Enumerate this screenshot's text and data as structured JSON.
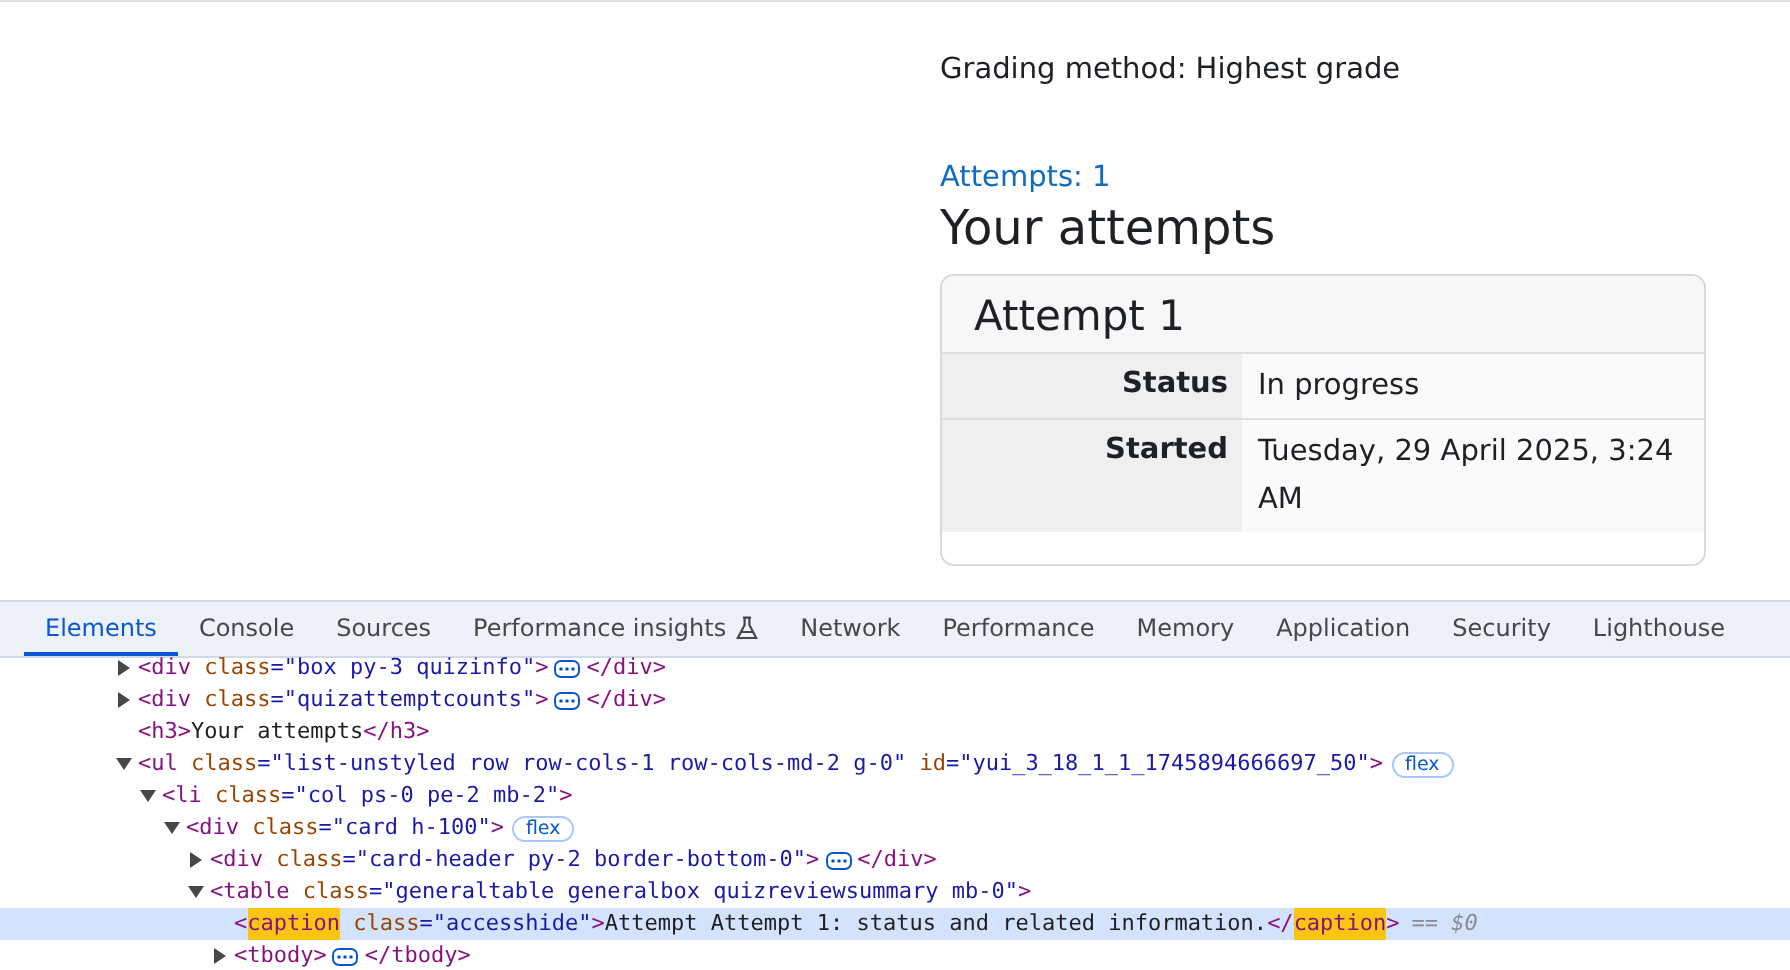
{
  "page": {
    "grading_method": "Grading method: Highest grade",
    "attempts_link": "Attempts: 1",
    "heading": "Your attempts",
    "card": {
      "title": "Attempt 1",
      "rows": [
        {
          "label": "Status",
          "value": "In progress"
        },
        {
          "label": "Started",
          "value": "Tuesday, 29 April 2025, 3:24 AM"
        }
      ]
    }
  },
  "devtools": {
    "tabs": [
      {
        "label": "Elements",
        "selected": true
      },
      {
        "label": "Console",
        "selected": false
      },
      {
        "label": "Sources",
        "selected": false
      },
      {
        "label": "Performance insights",
        "selected": false,
        "kind": "experiment"
      },
      {
        "label": "Network",
        "selected": false
      },
      {
        "label": "Performance",
        "selected": false
      },
      {
        "label": "Memory",
        "selected": false
      },
      {
        "label": "Application",
        "selected": false
      },
      {
        "label": "Security",
        "selected": false
      },
      {
        "label": "Lighthouse",
        "selected": false
      }
    ],
    "nodes": [
      {
        "expanded": false,
        "selected": false,
        "tokens": [
          {
            "kind": "tag",
            "text": "<div"
          },
          {
            "kind": "attr",
            "text": "class"
          },
          {
            "kind": "value",
            "text": "=\"box py-3 quizinfo\""
          },
          {
            "kind": "tag",
            "text": ">"
          },
          {
            "kind": "ellipsis"
          },
          {
            "kind": "tag",
            "text": "</div>"
          }
        ]
      },
      {
        "expanded": false,
        "selected": false,
        "tokens": [
          {
            "kind": "tag",
            "text": "<div"
          },
          {
            "kind": "attr",
            "text": "class"
          },
          {
            "kind": "value",
            "text": "=\"quizattemptcounts\""
          },
          {
            "kind": "tag",
            "text": ">"
          },
          {
            "kind": "ellipsis"
          },
          {
            "kind": "tag",
            "text": "</div>"
          }
        ]
      },
      {
        "selected": false,
        "tokens": [
          {
            "kind": "tag",
            "text": "<h3>"
          },
          {
            "kind": "text",
            "text": "Your attempts"
          },
          {
            "kind": "tag",
            "text": "</h3>"
          }
        ]
      },
      {
        "expanded": true,
        "selected": false,
        "tokens": [
          {
            "kind": "tag",
            "text": "<ul"
          },
          {
            "kind": "attr",
            "text": "class"
          },
          {
            "kind": "value",
            "text": "=\"list-unstyled row row-cols-1 row-cols-md-2 g-0\""
          },
          {
            "kind": "attr",
            "text": "id"
          },
          {
            "kind": "value",
            "text": "=\"yui_3_18_1_1_1745894666697_50\""
          },
          {
            "kind": "tag",
            "text": ">"
          },
          {
            "kind": "badge",
            "text": "flex"
          }
        ],
        "children": [
          {
            "expanded": true,
            "selected": false,
            "tokens": [
              {
                "kind": "tag",
                "text": "<li"
              },
              {
                "kind": "attr",
                "text": "class"
              },
              {
                "kind": "value",
                "text": "=\"col ps-0 pe-2 mb-2\""
              },
              {
                "kind": "tag",
                "text": ">"
              }
            ],
            "children": [
              {
                "expanded": true,
                "selected": false,
                "tokens": [
                  {
                    "kind": "tag",
                    "text": "<div"
                  },
                  {
                    "kind": "attr",
                    "text": "class"
                  },
                  {
                    "kind": "value",
                    "text": "=\"card h-100\""
                  },
                  {
                    "kind": "tag",
                    "text": ">"
                  },
                  {
                    "kind": "badge",
                    "text": "flex"
                  }
                ],
                "children": [
                  {
                    "expanded": false,
                    "selected": false,
                    "tokens": [
                      {
                        "kind": "tag",
                        "text": "<div"
                      },
                      {
                        "kind": "attr",
                        "text": "class"
                      },
                      {
                        "kind": "value",
                        "text": "=\"card-header py-2 border-bottom-0\""
                      },
                      {
                        "kind": "tag",
                        "text": ">"
                      },
                      {
                        "kind": "ellipsis"
                      },
                      {
                        "kind": "tag",
                        "text": "</div>"
                      }
                    ]
                  },
                  {
                    "expanded": true,
                    "selected": false,
                    "tokens": [
                      {
                        "kind": "tag",
                        "text": "<table"
                      },
                      {
                        "kind": "attr",
                        "text": "class"
                      },
                      {
                        "kind": "value",
                        "text": "=\"generaltable generalbox quizreviewsummary mb-0\""
                      },
                      {
                        "kind": "tag",
                        "text": ">"
                      }
                    ],
                    "children": [
                      {
                        "selected": true,
                        "tokens": [
                          {
                            "kind": "tag",
                            "text": "<"
                          },
                          {
                            "kind": "tag",
                            "text": "caption",
                            "highlighted": true
                          },
                          {
                            "kind": "attr",
                            "text": "class"
                          },
                          {
                            "kind": "value",
                            "text": "=\"accesshide\""
                          },
                          {
                            "kind": "tag",
                            "text": ">"
                          },
                          {
                            "kind": "text",
                            "text": "Attempt Attempt 1: status and related information."
                          },
                          {
                            "kind": "tag",
                            "text": "</"
                          },
                          {
                            "kind": "tag",
                            "text": "caption",
                            "highlighted": true
                          },
                          {
                            "kind": "tag",
                            "text": ">"
                          },
                          {
                            "kind": "marker",
                            "text": "== $0"
                          }
                        ]
                      },
                      {
                        "expanded": false,
                        "selected": false,
                        "tokens": [
                          {
                            "kind": "tag",
                            "text": "<tbody>"
                          },
                          {
                            "kind": "ellipsis"
                          },
                          {
                            "kind": "tag",
                            "text": "</tbody>"
                          }
                        ]
                      }
                    ]
                  }
                ]
              }
            ]
          }
        ]
      }
    ]
  }
}
